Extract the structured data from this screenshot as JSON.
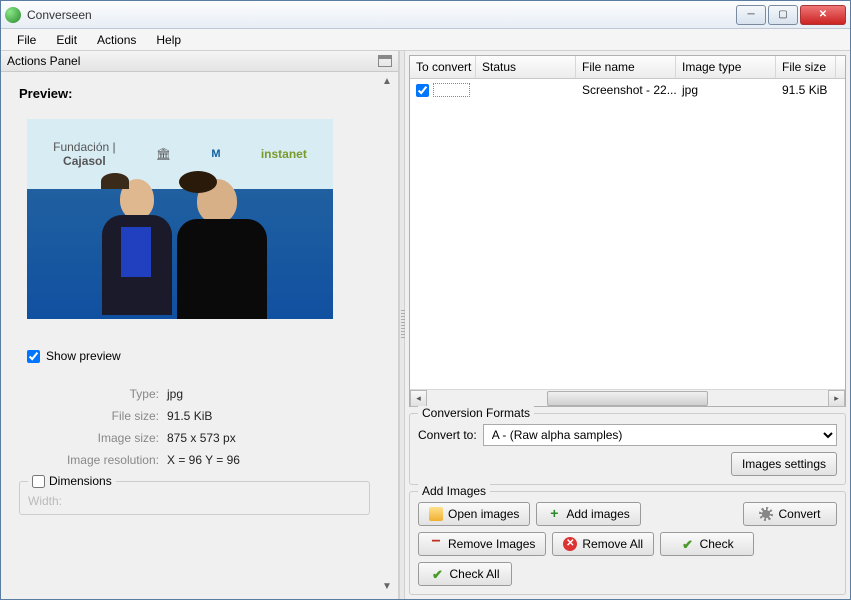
{
  "window": {
    "title": "Converseen"
  },
  "menu": {
    "file": "File",
    "edit": "Edit",
    "actions": "Actions",
    "help": "Help"
  },
  "actionsPanel": {
    "title": "Actions Panel",
    "previewTitle": "Preview:",
    "showPreview": "Show preview",
    "meta": {
      "typeLabel": "Type:",
      "typeVal": "jpg",
      "sizeLabel": "File size:",
      "sizeVal": "91.5 KiB",
      "imgSizeLabel": "Image size:",
      "imgSizeVal": "875 x 573 px",
      "resLabel": "Image resolution:",
      "resVal": "X = 96 Y = 96"
    },
    "dimensions": {
      "legend": "Dimensions",
      "widthLabel": "Width:"
    }
  },
  "table": {
    "headers": {
      "convert": "To convert",
      "status": "Status",
      "filename": "File name",
      "type": "Image type",
      "size": "File size"
    },
    "rows": [
      {
        "checked": true,
        "status": "",
        "filename": "Screenshot - 22...",
        "type": "jpg",
        "size": "91.5 KiB"
      }
    ]
  },
  "conversion": {
    "legend": "Conversion Formats",
    "convertToLabel": "Convert to:",
    "selected": "A - (Raw alpha samples)",
    "imagesSettings": "Images settings"
  },
  "addImages": {
    "legend": "Add Images",
    "open": "Open images",
    "add": "Add images",
    "convert": "Convert",
    "remove": "Remove Images",
    "removeAll": "Remove All",
    "check": "Check",
    "checkAll": "Check All"
  },
  "previewIcons": {
    "cajasol": "Cajasol",
    "instanet": "instanet"
  }
}
